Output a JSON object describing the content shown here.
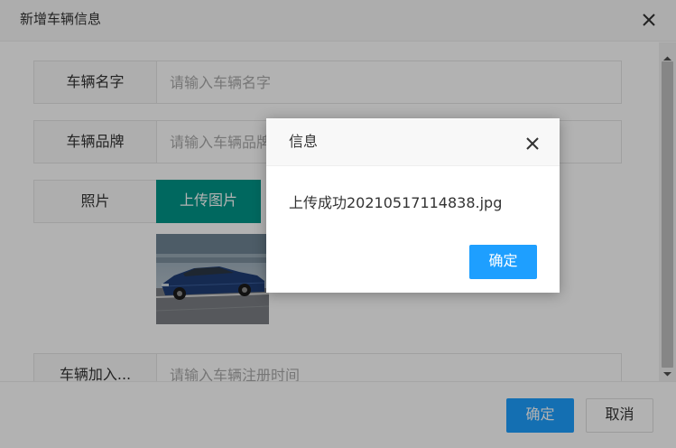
{
  "dialog": {
    "title": "新增车辆信息",
    "close_icon": "close-icon"
  },
  "form": {
    "name_label": "车辆名字",
    "name_placeholder": "请输入车辆名字",
    "brand_label": "车辆品牌",
    "brand_placeholder": "请输入车辆品牌",
    "photo_label": "照片",
    "upload_button": "上传图片",
    "photo_description": "blue sedan car photo",
    "date_label": "车辆加入...",
    "date_placeholder": "请输入车辆注册时间"
  },
  "footer": {
    "confirm_label": "确定",
    "cancel_label": "取消"
  },
  "message_dialog": {
    "title": "信息",
    "message": "上传成功20210517114838.jpg",
    "confirm_label": "确定"
  },
  "colors": {
    "upload_button": "#009688",
    "primary_button": "#1e9fff"
  }
}
